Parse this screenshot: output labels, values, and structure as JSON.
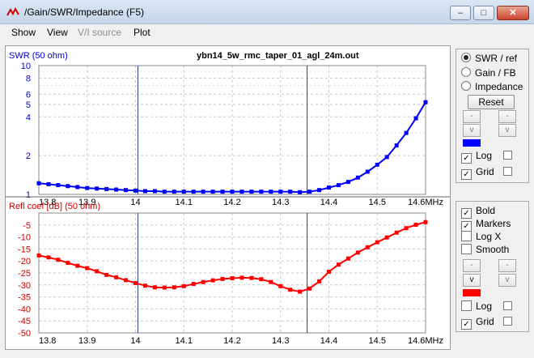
{
  "window": {
    "title": "/Gain/SWR/Impedance (F5)",
    "minimize": "–",
    "maximize": "□",
    "close": "✕"
  },
  "menu": {
    "items": [
      {
        "label": "Show",
        "enabled": true
      },
      {
        "label": "View",
        "enabled": true
      },
      {
        "label": "V/I source",
        "enabled": false
      },
      {
        "label": "Plot",
        "enabled": true
      }
    ]
  },
  "top_panel": {
    "options": [
      {
        "label": "SWR / ref",
        "selected": true
      },
      {
        "label": "Gain / FB",
        "selected": false
      },
      {
        "label": "Impedance",
        "selected": false
      }
    ],
    "reset_label": "Reset",
    "up_arrow": "-",
    "down_arrow": "v",
    "series_color": "#0000ff",
    "log_label": "Log",
    "log_checked": true,
    "grid_label": "Grid",
    "grid_checked": true
  },
  "bottom_panel": {
    "bold_label": "Bold",
    "bold_checked": true,
    "markers_label": "Markers",
    "markers_checked": true,
    "logx_label": "Log X",
    "logx_checked": false,
    "smooth_label": "Smooth",
    "smooth_checked": false,
    "up_arrow": "-",
    "down_arrow": "v",
    "series_color": "#ff0000",
    "log_label": "Log",
    "log_checked": false,
    "grid_label": "Grid",
    "grid_checked": true
  },
  "chart_data": [
    {
      "type": "line",
      "title": "ybn14_5w_rmc_taper_01_agl_24m.out",
      "ylabel": "SWR (50 ohm)",
      "xlabel": "",
      "y_scale": "log",
      "ylim": [
        1,
        10
      ],
      "xlim": [
        13.8,
        14.6
      ],
      "yticks": [
        1,
        2,
        4,
        5,
        6,
        8,
        10
      ],
      "xtick_labels": [
        "13.8",
        "13.9",
        "14",
        "14.1",
        "14.2",
        "14.3",
        "14.4",
        "14.5",
        "14.6MHz"
      ],
      "grid": true,
      "markers": true,
      "marker_lines_x": [
        14.005,
        14.355
      ],
      "color": "#0000ff",
      "series": [
        {
          "x": [
            13.8,
            13.82,
            13.84,
            13.86,
            13.88,
            13.9,
            13.92,
            13.94,
            13.96,
            13.98,
            14.0,
            14.02,
            14.04,
            14.06,
            14.08,
            14.1,
            14.12,
            14.14,
            14.16,
            14.18,
            14.2,
            14.22,
            14.24,
            14.26,
            14.28,
            14.3,
            14.32,
            14.34,
            14.36,
            14.38,
            14.4,
            14.42,
            14.44,
            14.46,
            14.48,
            14.5,
            14.52,
            14.54,
            14.56,
            14.58,
            14.6
          ],
          "values": [
            1.22,
            1.2,
            1.18,
            1.16,
            1.14,
            1.12,
            1.11,
            1.1,
            1.09,
            1.08,
            1.07,
            1.06,
            1.06,
            1.05,
            1.05,
            1.05,
            1.05,
            1.05,
            1.05,
            1.05,
            1.05,
            1.05,
            1.05,
            1.05,
            1.05,
            1.05,
            1.05,
            1.04,
            1.05,
            1.08,
            1.13,
            1.18,
            1.25,
            1.35,
            1.5,
            1.7,
            1.95,
            2.4,
            3.0,
            3.9,
            5.2
          ]
        }
      ]
    },
    {
      "type": "line",
      "title": "",
      "ylabel": "Refl coef [dB] (50 ohm)",
      "xlabel": "",
      "ylim": [
        -50,
        0
      ],
      "xlim": [
        13.8,
        14.6
      ],
      "yticks": [
        -5,
        -10,
        -15,
        -20,
        -25,
        -30,
        -35,
        -40,
        -45,
        -50
      ],
      "xtick_labels": [
        "13.8",
        "13.9",
        "14",
        "14.1",
        "14.2",
        "14.3",
        "14.4",
        "14.5",
        "14.6MHz"
      ],
      "grid": true,
      "markers": true,
      "marker_lines_x": [
        14.005,
        14.355
      ],
      "color": "#ff0000",
      "series": [
        {
          "x": [
            13.8,
            13.82,
            13.84,
            13.86,
            13.88,
            13.9,
            13.92,
            13.94,
            13.96,
            13.98,
            14.0,
            14.02,
            14.04,
            14.06,
            14.08,
            14.1,
            14.12,
            14.14,
            14.16,
            14.18,
            14.2,
            14.22,
            14.24,
            14.26,
            14.28,
            14.3,
            14.32,
            14.34,
            14.36,
            14.38,
            14.4,
            14.42,
            14.44,
            14.46,
            14.48,
            14.5,
            14.52,
            14.54,
            14.56,
            14.58,
            14.6
          ],
          "values": [
            -17.7,
            -18.5,
            -19.5,
            -20.8,
            -22.0,
            -23.0,
            -24.3,
            -25.8,
            -26.8,
            -28.0,
            -29.2,
            -30.3,
            -31.0,
            -31.1,
            -31.0,
            -30.5,
            -29.6,
            -28.8,
            -28.1,
            -27.5,
            -27.2,
            -27.0,
            -27.1,
            -27.6,
            -28.8,
            -30.5,
            -32.0,
            -32.8,
            -31.5,
            -28.5,
            -24.5,
            -21.5,
            -19.0,
            -16.5,
            -14.3,
            -12.2,
            -10.2,
            -8.2,
            -6.3,
            -4.9,
            -3.8
          ]
        }
      ]
    }
  ]
}
